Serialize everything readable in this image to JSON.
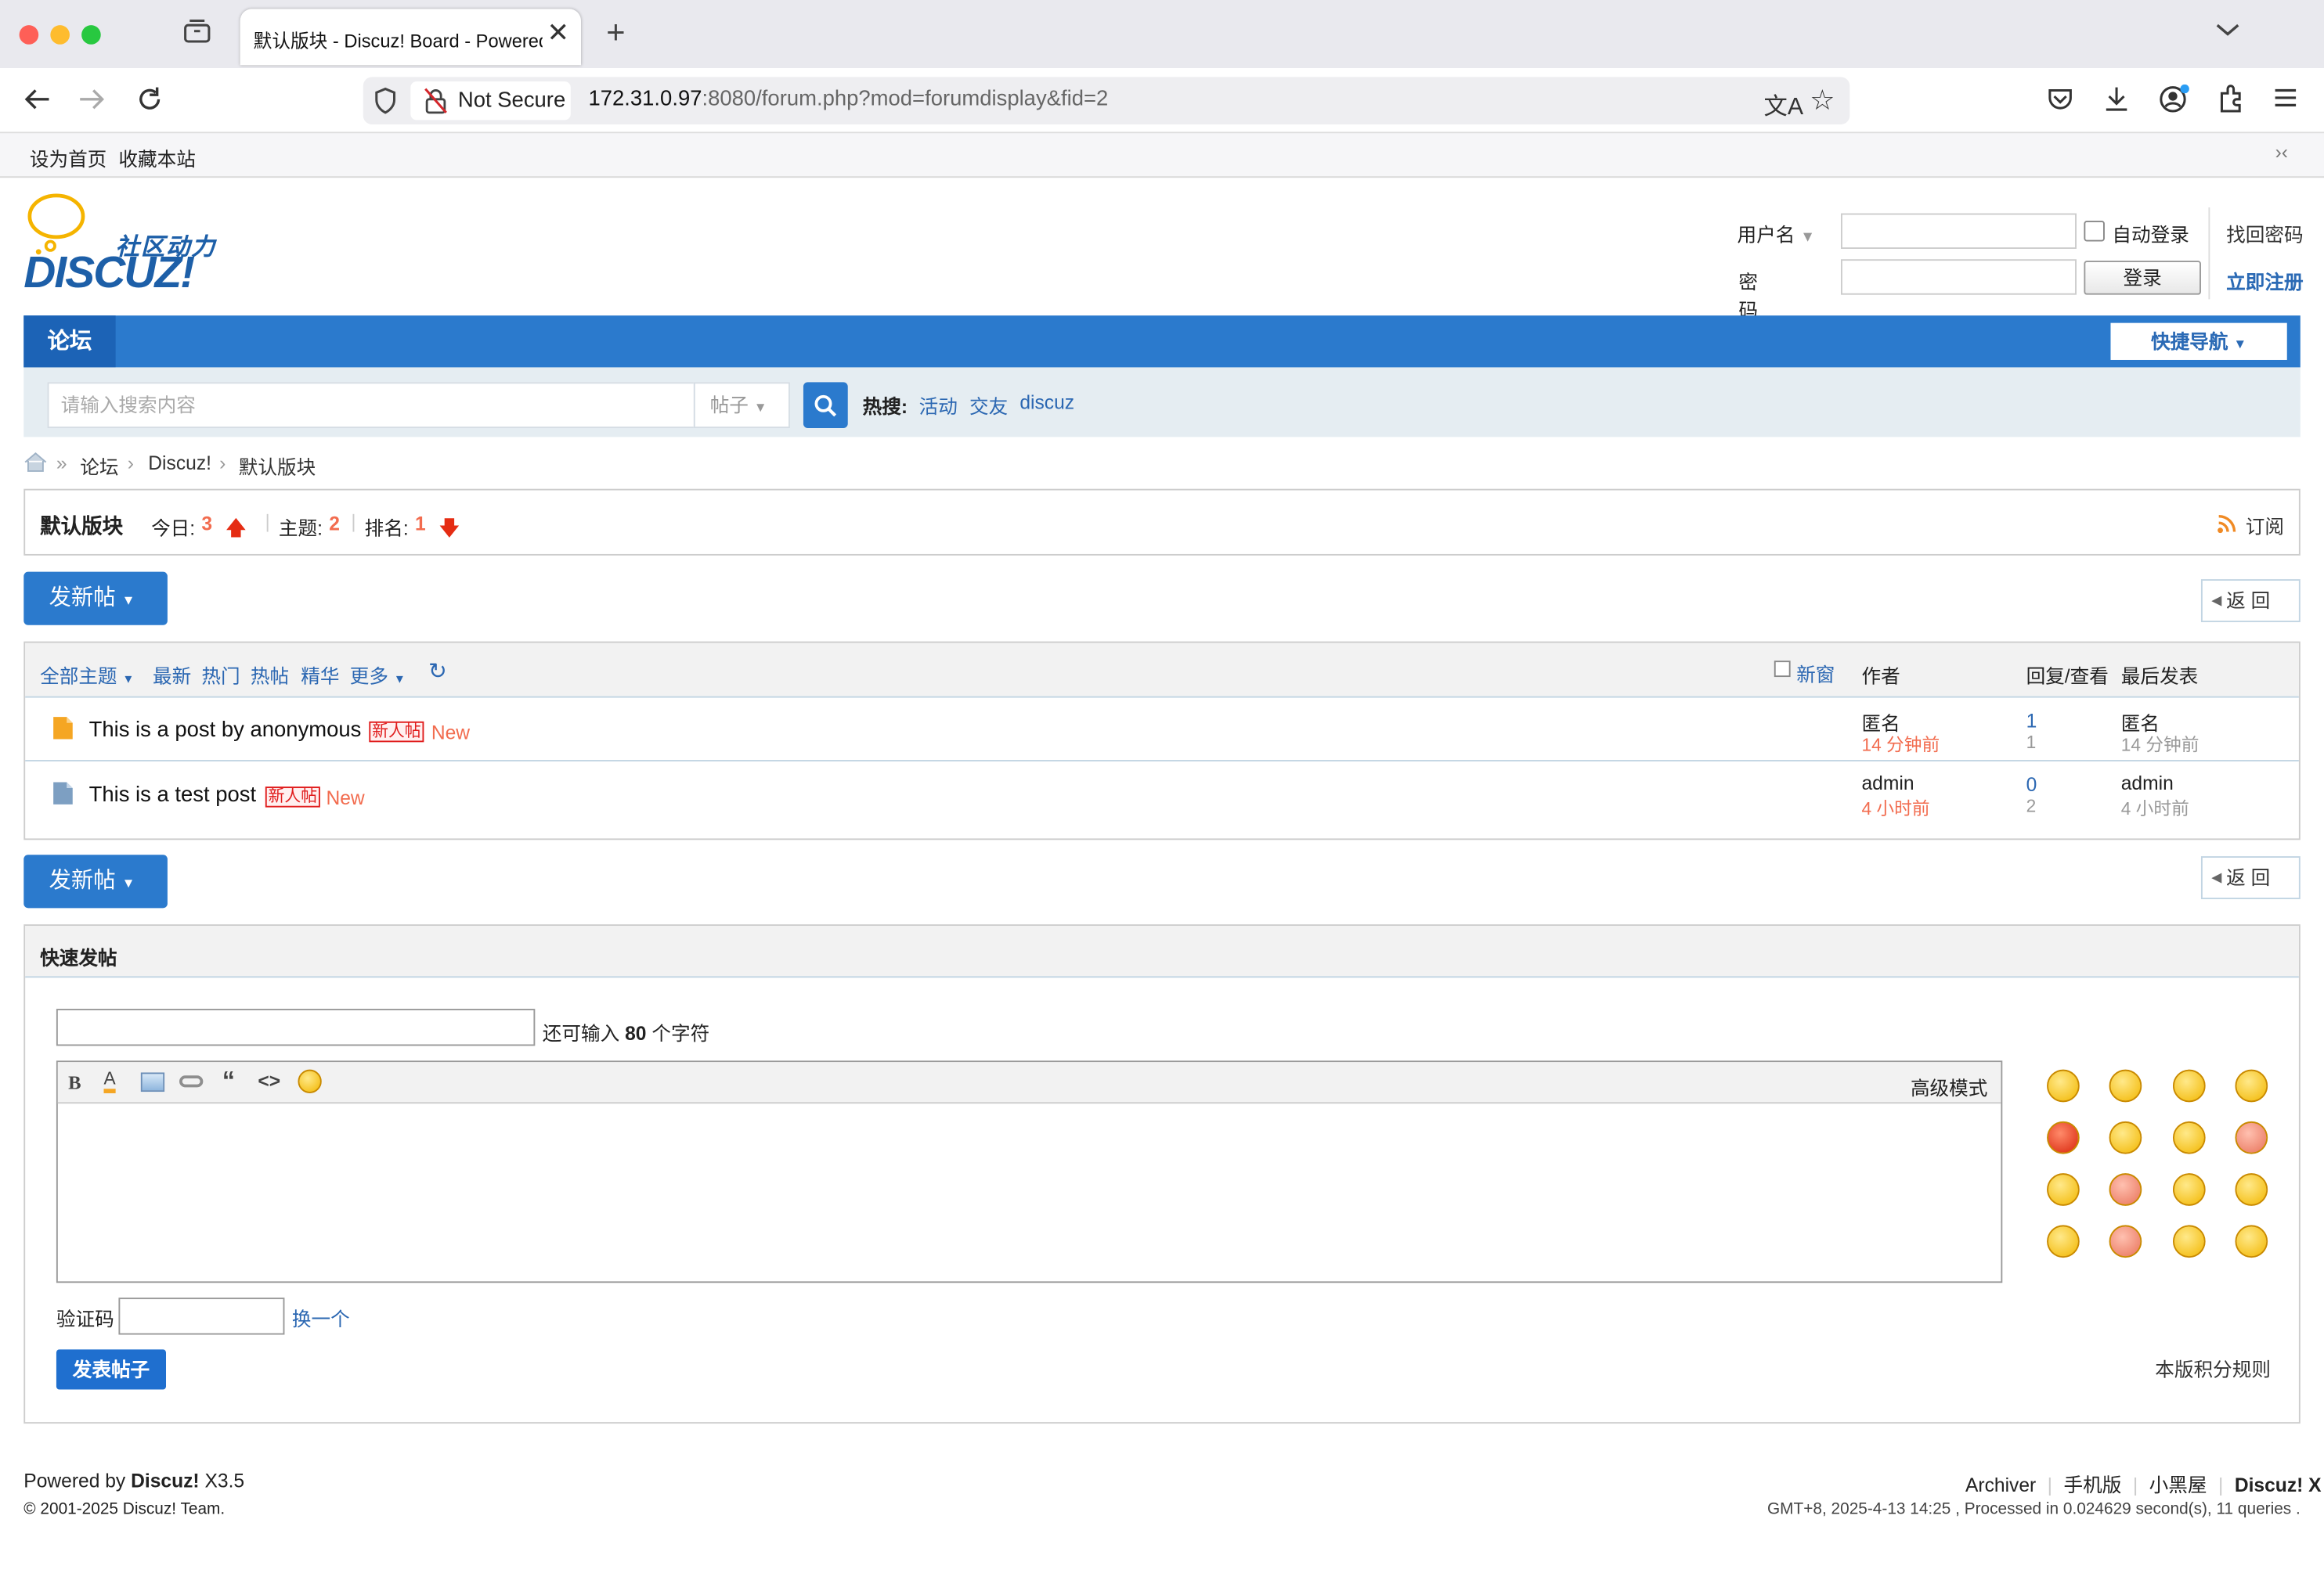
{
  "browser": {
    "tab_title": "默认版块 - Discuz! Board - Powered",
    "url_host": "172.31.0.97",
    "url_rest": ":8080/forum.php?mod=forumdisplay&fid=2",
    "security_label": "Not Secure",
    "bookmarks": [
      "设为首页",
      "收藏本站"
    ]
  },
  "header": {
    "logo_text": "社区动力",
    "logo_brand": "DISCUZ!",
    "username_label": "用户名",
    "password_label": "密码",
    "auto_login": "自动登录",
    "find_password": "找回密码",
    "login_button": "登录",
    "register": "立即注册"
  },
  "nav": {
    "forum": "论坛",
    "quick_nav": "快捷导航"
  },
  "search": {
    "placeholder": "请输入搜索内容",
    "type": "帖子",
    "hot_label": "热搜:",
    "hot_terms": [
      "活动",
      "交友",
      "discuz"
    ]
  },
  "breadcrumb": [
    "论坛",
    "Discuz!",
    "默认版块"
  ],
  "forum_info": {
    "name": "默认版块",
    "today_label": "今日:",
    "today": "3",
    "topics_label": "主题:",
    "topics": "2",
    "rank_label": "排名:",
    "rank": "1",
    "subscribe": "订阅"
  },
  "actions": {
    "new_post": "发新帖",
    "back": "返 回"
  },
  "filters": {
    "all": "全部主题",
    "items": [
      "最新",
      "热门",
      "热帖",
      "精华"
    ],
    "more": "更多",
    "new_window": "新窗",
    "col_author": "作者",
    "col_replies": "回复/查看",
    "col_last": "最后发表"
  },
  "threads": [
    {
      "title": "This is a post by anonymous",
      "badge": "新人帖",
      "new": "New",
      "author": "匿名",
      "author_time": "14 分钟前",
      "replies": "1",
      "views": "1",
      "last_author": "匿名",
      "last_time": "14 分钟前"
    },
    {
      "title": "This is a test post",
      "badge": "新人帖",
      "new": "New",
      "author": "admin",
      "author_time": "4 小时前",
      "replies": "0",
      "views": "2",
      "last_author": "admin",
      "last_time": "4 小时前"
    }
  ],
  "quick_post": {
    "title": "快速发帖",
    "remaining_pre": "还可输入",
    "remaining": "80",
    "remaining_post": "个字符",
    "advanced": "高级模式",
    "captcha_label": "验证码",
    "captcha_change": "换一个",
    "submit": "发表帖子",
    "rules": "本版积分规则"
  },
  "footer": {
    "powered_pre": "Powered by",
    "powered_brand": "Discuz!",
    "version": "X3.5",
    "copyright": "© 2001-2025",
    "copyright_brand": "Discuz! Team.",
    "links": [
      "Archiver",
      "手机版",
      "小黑屋"
    ],
    "brand": "Discuz! X",
    "stats": "GMT+8, 2025-4-13 14:25 , Processed in 0.024629 second(s), 11 queries ."
  },
  "colors": {
    "primary": "#2b7acd",
    "accent_red": "#f26c4f",
    "link": "#336699"
  }
}
